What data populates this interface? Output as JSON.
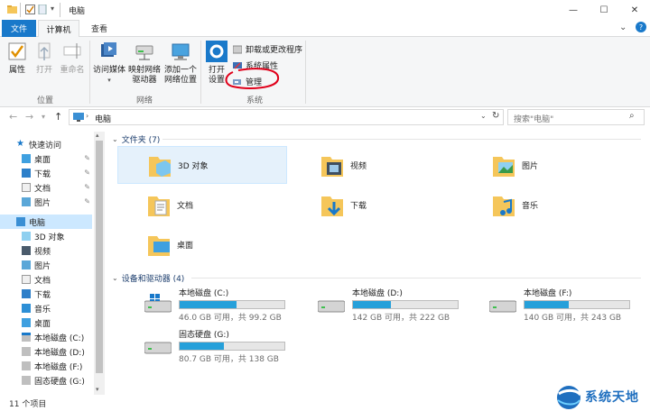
{
  "window": {
    "title": "电脑"
  },
  "tabs": [
    {
      "label": "文件"
    },
    {
      "label": "计算机"
    },
    {
      "label": "查看"
    }
  ],
  "ribbon": {
    "location_group": {
      "label": "位置",
      "buttons": [
        {
          "label": "属性"
        },
        {
          "label": "打开"
        },
        {
          "label": "重命名"
        }
      ]
    },
    "network_group": {
      "label": "网络",
      "buttons": [
        {
          "label": "访问媒体"
        },
        {
          "label": "映射网络\n驱动器"
        },
        {
          "label": "添加一个\n网络位置"
        }
      ]
    },
    "system_group": {
      "label": "系统",
      "open_settings": "打开\n设置",
      "items": [
        {
          "label": "卸载或更改程序"
        },
        {
          "label": "系统属性"
        },
        {
          "label": "管理"
        }
      ]
    }
  },
  "address": {
    "path": "电脑",
    "search_placeholder": "搜索\"电脑\""
  },
  "nav": {
    "quick_access": "快速访问",
    "quick_items": [
      {
        "label": "桌面"
      },
      {
        "label": "下载"
      },
      {
        "label": "文档"
      },
      {
        "label": "图片"
      }
    ],
    "this_pc": "电脑",
    "pc_items": [
      {
        "label": "3D 对象"
      },
      {
        "label": "视频"
      },
      {
        "label": "图片"
      },
      {
        "label": "文档"
      },
      {
        "label": "下载"
      },
      {
        "label": "音乐"
      },
      {
        "label": "桌面"
      },
      {
        "label": "本地磁盘 (C:)"
      },
      {
        "label": "本地磁盘 (D:)"
      },
      {
        "label": "本地磁盘 (F:)"
      },
      {
        "label": "固态硬盘 (G:)"
      }
    ]
  },
  "content": {
    "folders_header": "文件夹 (7)",
    "folders": [
      {
        "label": "3D 对象"
      },
      {
        "label": "视频"
      },
      {
        "label": "图片"
      },
      {
        "label": "文档"
      },
      {
        "label": "下载"
      },
      {
        "label": "音乐"
      },
      {
        "label": "桌面"
      }
    ],
    "drives_header": "设备和驱动器 (4)",
    "drives": [
      {
        "label": "本地磁盘 (C:)",
        "free": "46.0 GB 可用，共 99.2 GB",
        "used_fraction": 0.54
      },
      {
        "label": "本地磁盘 (D:)",
        "free": "142 GB 可用，共 222 GB",
        "used_fraction": 0.36
      },
      {
        "label": "本地磁盘 (F:)",
        "free": "140 GB 可用，共 243 GB",
        "used_fraction": 0.42
      },
      {
        "label": "固态硬盘 (G:)",
        "free": "80.7 GB 可用，共 138 GB",
        "used_fraction": 0.42
      }
    ]
  },
  "status": {
    "count": "11 个项目"
  },
  "watermark": {
    "text": "系统天地"
  },
  "colors": {
    "accent": "#1979ca",
    "bar": "#26a0da",
    "annotation": "#e0001a"
  }
}
